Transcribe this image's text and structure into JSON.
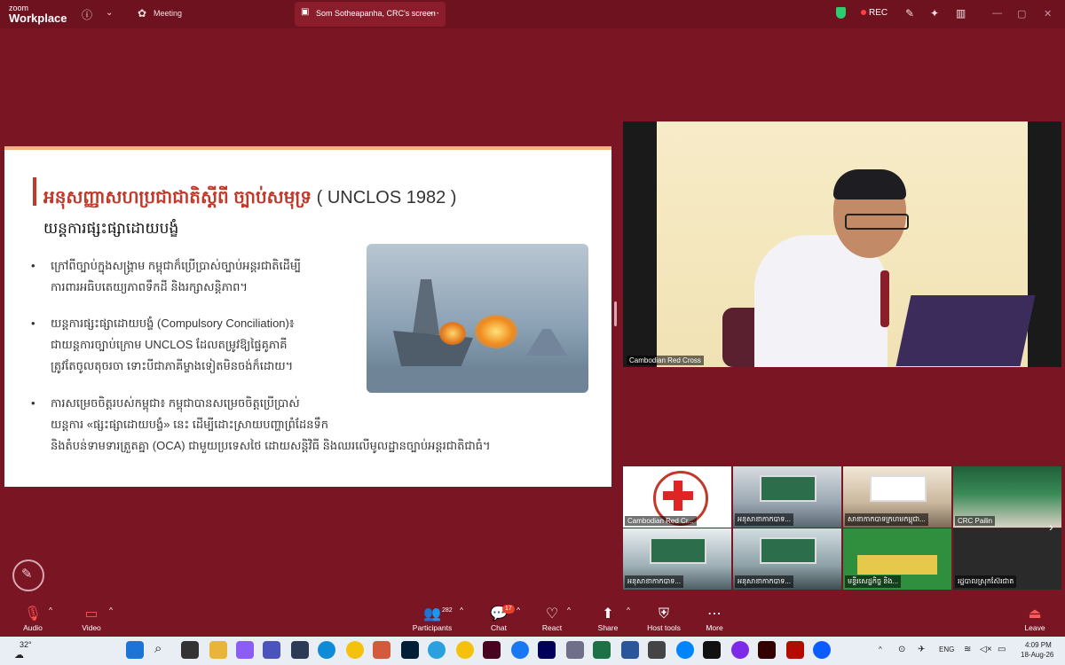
{
  "app": {
    "brand_line1": "zoom",
    "brand_line2": "Workplace"
  },
  "topbar": {
    "meeting_label": "Meeting",
    "share_label": "Som Sotheapanha, CRC's screen",
    "rec_label": "REC"
  },
  "slide": {
    "title_khmer": "អនុសញ្ញាសហប្រជាជាតិស្តីពី ច្បាប់សមុទ្រ",
    "title_tag": "( UNCLOS 1982 )",
    "subtitle": "យន្តការផ្សះផ្សាដោយបង្ខំ",
    "bullets": [
      {
        "line1": "ក្រៅពីច្បាប់ក្នុងសង្គ្រាម កម្ពុជាក៏ប្រើប្រាស់ច្បាប់អន្តរជាតិដើម្បី",
        "line2": "ការពារអធិបតេយ្យភាពទឹកដី និងរក្សាសន្តិភាព។",
        "line3": ""
      },
      {
        "line1": "យន្តការផ្សះផ្សាដោយបង្ខំ (Compulsory Conciliation)៖",
        "line2": "ជាយន្តការច្បាប់ក្រោម UNCLOS ដែលតម្រូវឱ្យផ្ទៃគូភាគី",
        "line3": "ត្រូវតែចូលតុចរចា ទោះបីជាភាគីម្ខាងទៀតមិនចង់ក៏ដោយ។"
      },
      {
        "line1": "ការសម្រេចចិត្តរបស់កម្ពុជា៖ កម្ពុជាបានសម្រេចចិត្តប្រើប្រាស់",
        "line2": "យន្តការ «ផ្សះផ្សាដោយបង្ខំ» នេះ ដើម្បីដោះស្រាយបញ្ហាព្រំដែនទឹក",
        "line3": "និងតំបន់ទាមទារត្រួតគ្នា (OCA) ជាមួយប្រទេសថៃ ដោយសន្តិវិធី និងឈរលើមូលដ្ឋានច្បាប់អន្តរជាតិជាធំ។"
      }
    ]
  },
  "speaker": {
    "name": "Cambodian Red Cross"
  },
  "gallery": [
    {
      "name": "Cambodian Red Cr..."
    },
    {
      "name": "អនុសាខាកាកបាទ..."
    },
    {
      "name": "សាខាកាកបាទក្រហមកម្ពុជា..."
    },
    {
      "name": "CRC Pailin"
    },
    {
      "name": "អនុសាខាកាកបាទ..."
    },
    {
      "name": "អនុសាខាកាកបាទ..."
    },
    {
      "name": "មន្ទីរសេដ្ឋកិច្ច និង..."
    },
    {
      "name": "រដ្ឋបាលស្រុកស៊ែរជាត"
    }
  ],
  "controls": {
    "audio": "Audio",
    "video": "Video",
    "participants": "Participants",
    "participants_count": "282",
    "chat": "Chat",
    "chat_badge": "17",
    "react": "React",
    "share": "Share",
    "host_tools": "Host tools",
    "more": "More",
    "leave": "Leave"
  },
  "taskbar": {
    "weather": "32°",
    "language": "ENG",
    "time": "4:09 PM",
    "date": "18-Aug-26"
  },
  "colors": {
    "zoom_bg": "#7a1524",
    "slide_title": "#c0392b",
    "leave_red": "#e02424"
  }
}
